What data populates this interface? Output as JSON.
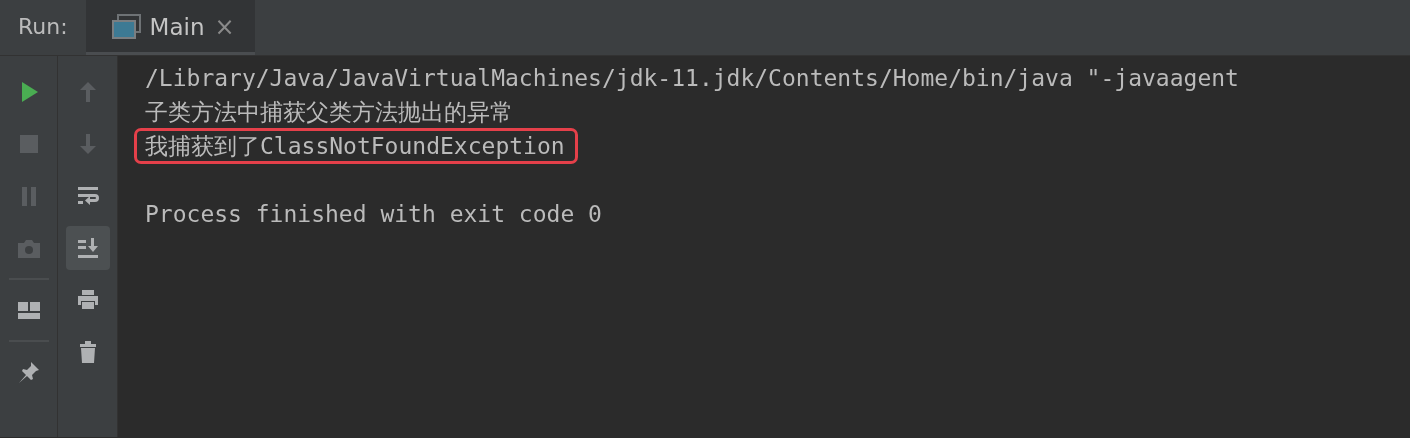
{
  "header": {
    "label": "Run:"
  },
  "tabs": [
    {
      "label": "Main",
      "selected": true,
      "close": "×"
    }
  ],
  "left_toolbar": [
    {
      "kind": "run",
      "disabled": false
    },
    {
      "kind": "stop",
      "disabled": true
    },
    {
      "kind": "pause",
      "disabled": true
    },
    {
      "kind": "camera",
      "disabled": true
    },
    {
      "kind": "separator"
    },
    {
      "kind": "layout",
      "disabled": false
    },
    {
      "kind": "separator"
    },
    {
      "kind": "pin",
      "disabled": false
    }
  ],
  "right_toolbar": [
    {
      "kind": "up",
      "disabled": true,
      "on": false
    },
    {
      "kind": "down",
      "disabled": true,
      "on": false
    },
    {
      "kind": "wrap",
      "disabled": false,
      "on": false
    },
    {
      "kind": "scroll-end",
      "disabled": false,
      "on": true
    },
    {
      "kind": "print",
      "disabled": false,
      "on": false
    },
    {
      "kind": "trash",
      "disabled": false,
      "on": false
    }
  ],
  "console": [
    {
      "text": "/Library/Java/JavaVirtualMachines/jdk-11.jdk/Contents/Home/bin/java \"-javaagent",
      "highlighted": false
    },
    {
      "text": "子类方法中捕获父类方法抛出的异常",
      "highlighted": false
    },
    {
      "text": "我捕获到了ClassNotFoundException",
      "highlighted": true
    },
    {
      "text": "Process finished with exit code 0",
      "highlighted": false,
      "blank_before": true
    }
  ]
}
